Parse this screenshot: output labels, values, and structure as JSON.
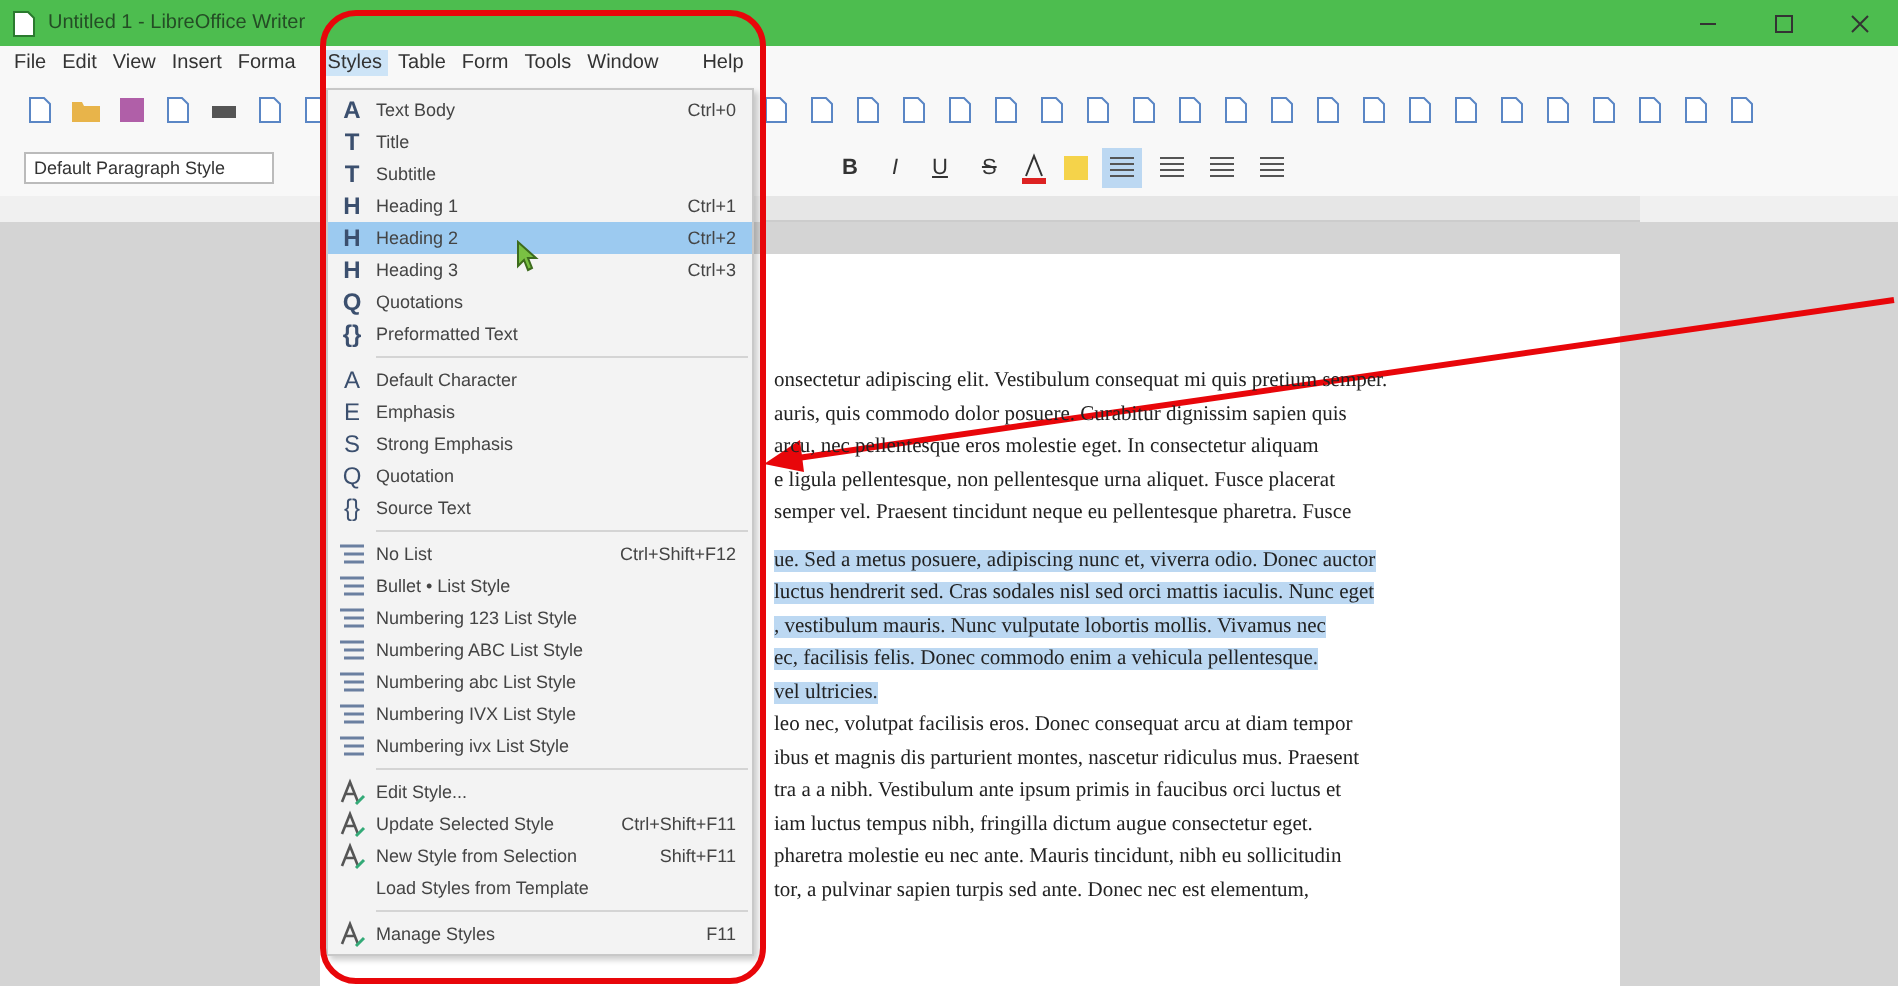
{
  "window": {
    "title": "Untitled 1 - LibreOffice Writer"
  },
  "menubar": [
    {
      "label": "File",
      "selected": false
    },
    {
      "label": "Edit",
      "selected": false
    },
    {
      "label": "View",
      "selected": false
    },
    {
      "label": "Insert",
      "selected": false
    },
    {
      "label": "Forma",
      "selected": false
    },
    {
      "label": "Styles",
      "selected": true
    },
    {
      "label": "Table",
      "selected": false
    },
    {
      "label": "Form",
      "selected": false
    },
    {
      "label": "Tools",
      "selected": false
    },
    {
      "label": "Window",
      "selected": false
    },
    {
      "label": "Help",
      "selected": false
    }
  ],
  "formatting_toolbar": {
    "paragraph_style": "Default Paragraph Style",
    "text_buttons": [
      {
        "label": "B",
        "kind": "bold"
      },
      {
        "label": "I",
        "kind": "italic"
      },
      {
        "label": "U",
        "kind": "underline"
      },
      {
        "label": "S",
        "kind": "strike"
      }
    ],
    "alignment": [
      {
        "selected": true
      },
      {
        "selected": false
      },
      {
        "selected": false
      },
      {
        "selected": false
      }
    ]
  },
  "styles_menu": {
    "groups": [
      {
        "kind": "paragraph",
        "items": [
          {
            "glyph": "A",
            "label": "Text Body",
            "shortcut": "Ctrl+0",
            "selected": false
          },
          {
            "glyph": "T",
            "label": "Title",
            "selected": false
          },
          {
            "glyph": "T",
            "label": "Subtitle",
            "selected": false
          },
          {
            "glyph": "H",
            "label": "Heading 1",
            "shortcut": "Ctrl+1",
            "selected": false
          },
          {
            "glyph": "H",
            "label": "Heading 2",
            "shortcut": "Ctrl+2",
            "selected": true
          },
          {
            "glyph": "H",
            "label": "Heading 3",
            "shortcut": "Ctrl+3",
            "selected": false
          },
          {
            "glyph": "Q",
            "label": "Quotations",
            "selected": false
          },
          {
            "glyph": "{}",
            "label": "Preformatted Text",
            "selected": false
          }
        ]
      },
      {
        "kind": "character",
        "items": [
          {
            "glyph": "A",
            "label": "Default Character",
            "selected": false
          },
          {
            "glyph": "E",
            "label": "Emphasis",
            "selected": false
          },
          {
            "glyph": "S",
            "label": "Strong Emphasis",
            "selected": false
          },
          {
            "glyph": "Q",
            "label": "Quotation",
            "selected": false
          },
          {
            "glyph": "{}",
            "label": "Source Text",
            "selected": false
          }
        ]
      },
      {
        "kind": "list",
        "items": [
          {
            "label": "No List",
            "shortcut": "Ctrl+Shift+F12",
            "selected": false
          },
          {
            "label": "Bullet • List Style",
            "selected": false
          },
          {
            "label": "Numbering 123 List Style",
            "selected": false
          },
          {
            "label": "Numbering ABC List Style",
            "selected": false
          },
          {
            "label": "Numbering abc List Style",
            "selected": false
          },
          {
            "label": "Numbering IVX List Style",
            "selected": false
          },
          {
            "label": "Numbering ivx List Style",
            "selected": false
          }
        ]
      },
      {
        "kind": "action",
        "items": [
          {
            "label": "Edit Style...",
            "icon": true,
            "selected": false
          },
          {
            "label": "Update Selected Style",
            "shortcut": "Ctrl+Shift+F11",
            "icon": true,
            "selected": false
          },
          {
            "label": "New Style from Selection",
            "shortcut": "Shift+F11",
            "icon": true,
            "selected": false
          },
          {
            "label": "Load Styles from Template",
            "icon": false,
            "selected": false
          }
        ]
      },
      {
        "kind": "action",
        "items": [
          {
            "label": "Manage Styles",
            "shortcut": "F11",
            "icon": true,
            "selected": false
          }
        ]
      }
    ]
  },
  "document": {
    "paragraphs": [
      {
        "lines": [
          {
            "text": "onsectetur adipiscing elit. Vestibulum consequat mi quis pretium semper.",
            "selected": false
          },
          {
            "text": "auris, quis commodo dolor posuere. Curabitur dignissim sapien quis",
            "selected": false
          },
          {
            "text": "arcu, nec pellentesque eros molestie eget. In consectetur aliquam",
            "selected": false
          },
          {
            "text": "e ligula pellentesque, non pellentesque urna aliquet. Fusce placerat",
            "selected": false
          },
          {
            "text": "semper vel. Praesent tincidunt neque eu pellentesque pharetra. Fusce",
            "selected": false
          }
        ]
      },
      {
        "lines": [
          {
            "text": "ue. Sed a metus posuere, adipiscing nunc et, viverra odio. Donec auctor",
            "selected": true
          },
          {
            "text": "luctus hendrerit sed. Cras sodales nisl sed orci mattis iaculis. Nunc eget",
            "selected": true
          },
          {
            "text": ", vestibulum mauris. Nunc vulputate lobortis mollis. Vivamus nec",
            "selected": true
          },
          {
            "text": "ec, facilisis felis. Donec commodo enim a vehicula pellentesque.",
            "selected": true
          },
          {
            "text": "vel ultricies.",
            "selected": true
          },
          {
            "text": "leo nec, volutpat facilisis eros. Donec consequat arcu at diam tempor",
            "selected": false
          },
          {
            "text": "ibus et magnis dis parturient montes, nascetur ridiculus mus. Praesent",
            "selected": false
          },
          {
            "text": "tra a a nibh. Vestibulum ante ipsum primis in faucibus orci luctus et",
            "selected": false
          },
          {
            "text": "iam luctus tempus nibh, fringilla dictum augue consectetur eget.",
            "selected": false
          },
          {
            "text": "pharetra molestie eu nec ante. Mauris tincidunt, nibh eu sollicitudin",
            "selected": false
          },
          {
            "text": "tor, a pulvinar sapien turpis sed ante. Donec nec est elementum,",
            "selected": false
          }
        ]
      }
    ]
  }
}
